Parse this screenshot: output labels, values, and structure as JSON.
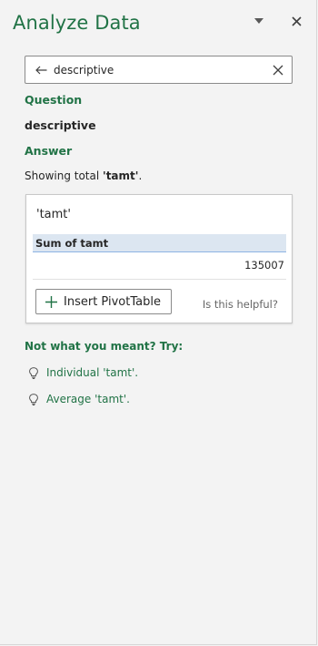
{
  "header": {
    "title": "Analyze Data",
    "dropdown_icon": "chevron-down-icon",
    "close_icon": "close-icon"
  },
  "search": {
    "value": "descriptive",
    "back_icon": "arrow-left-icon",
    "clear_icon": "close-icon"
  },
  "question": {
    "label": "Question",
    "text": "descriptive"
  },
  "answer": {
    "label": "Answer",
    "prefix": "Showing total ",
    "field": "'tamt'",
    "suffix": "."
  },
  "card": {
    "title": "'tamt'",
    "column_header": "Sum of tamt",
    "value": "135007",
    "insert_label": "Insert PivotTable",
    "insert_icon": "plus-icon",
    "helpful_text": "Is this helpful?"
  },
  "suggestions": {
    "heading": "Not what you meant? Try:",
    "items": [
      {
        "label": "Individual 'tamt'.",
        "icon": "lightbulb-icon"
      },
      {
        "label": "Average 'tamt'.",
        "icon": "lightbulb-icon"
      }
    ]
  },
  "colors": {
    "accent": "#217346",
    "pane_bg": "#f3f3f3",
    "pivot_header_bg": "#dce6f1"
  }
}
